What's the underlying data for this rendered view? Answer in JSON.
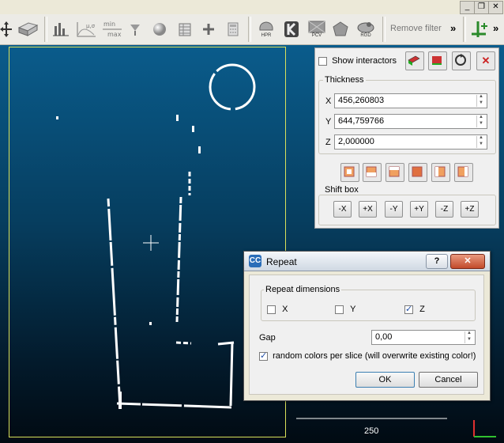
{
  "toolbar": {
    "remove_filter_label": "Remove filter",
    "overflow_label": "»",
    "buttons": [
      "HPR",
      "PCV",
      "RGD"
    ]
  },
  "window_controls": {
    "minimize": "_",
    "restore": "❐",
    "close": "✕"
  },
  "viewport": {
    "scale_label": "250"
  },
  "interactors_panel": {
    "show_interactors_label": "Show interactors",
    "show_interactors_checked": false,
    "thickness_label": "Thickness",
    "thickness": {
      "x_label": "X",
      "x_value": "456,260803",
      "y_label": "Y",
      "y_value": "644,759766",
      "z_label": "Z",
      "z_value": "2,000000"
    },
    "shift_box_label": "Shift box",
    "shift_buttons": [
      "-X",
      "+X",
      "-Y",
      "+Y",
      "-Z",
      "+Z"
    ]
  },
  "repeat_dialog": {
    "title": "Repeat",
    "help": "?",
    "close": "✕",
    "repeat_dimensions_label": "Repeat dimensions",
    "dim_x_label": "X",
    "dim_x_checked": false,
    "dim_y_label": "Y",
    "dim_y_checked": false,
    "dim_z_label": "Z",
    "dim_z_checked": true,
    "gap_label": "Gap",
    "gap_value": "0,00",
    "random_colors_label": "random colors per slice (will overwrite existing color!)",
    "random_colors_checked": true,
    "ok_label": "OK",
    "cancel_label": "Cancel"
  },
  "colors": {
    "accent": "#1f4da6",
    "viewport_top": "#0a5c8c",
    "frame": "#d9e05a"
  }
}
